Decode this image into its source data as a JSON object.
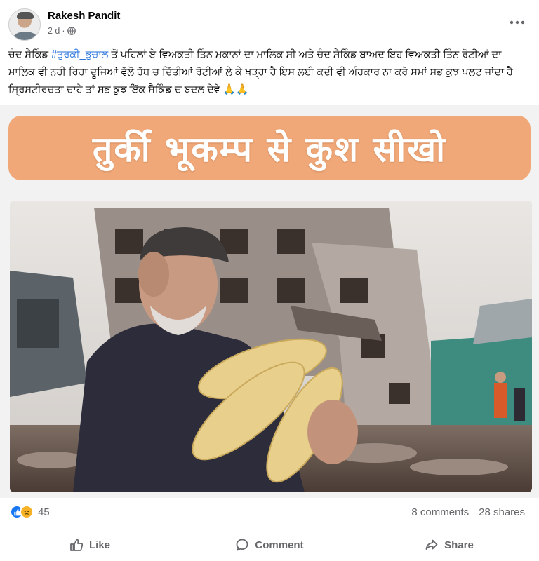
{
  "post": {
    "author": "Rakesh Pandit",
    "time": "2 d",
    "meta_separator": "·",
    "text_before_tag": "ਚੰਦ ਸੈਕਿੰਡ ",
    "hashtag": "#ਤੁਰਕੀ_ਭੁਚਾਲ",
    "text_after_tag": " ਤੋਂ ਪਹਿਲਾਂ ਏ ਵਿਅਕਤੀ ਤਿੰਨ ਮਕਾਨਾਂ ਦਾ ਮਾਲਿਕ ਸੀ ਅਤੇ ਚੰਦ ਸੈਕਿੰਡ ਬਾਅਦ ਇਹ ਵਿਅਕਤੀ ਤਿੰਨ ਰੋਟੀਆਂ ਦਾ ਮਾਲਿਕ ਵੀ ਨਹੀ ਰਿਹਾ ਦੂਜਿਆਂ ਵੱਲੋ ਹੱਥ ਚ ਦਿੱਤੀਆਂ ਰੋਟੀਆਂ ਲੇ ਕੇ ਖੜ੍ਹਾ ਹੈ ਇਸ ਲਈ ਕਦੀ ਵੀ ਅੰਹਕਾਰ ਨਾ ਕਰੋ ਸਮਾਂ ਸਭ ਕੁਝ ਪਲਟ ਜਾਂਦਾ ਹੈ ਸ੍ਰਿਸਟੀਰਚਤਾ ਚਾਹੇ ਤਾਂ ਸਭ ਕੁਝ ਇੱਕ ਸੈਕਿੰਡ ਚ ਬਦਲ ਦੇਵੇ 🙏🙏"
  },
  "image": {
    "banner_text": "तुर्की भूकम्प से कुश सीखो"
  },
  "stats": {
    "reaction_count": "45",
    "comments": "8 comments",
    "shares": "28 shares"
  },
  "actions": {
    "like": "Like",
    "comment": "Comment",
    "share": "Share"
  },
  "icons": {
    "globe": "globe-icon",
    "more": "more-options-icon",
    "like": "thumbs-up-icon",
    "comment": "comment-bubble-icon",
    "share": "share-arrow-icon",
    "reaction_like": "like-reaction-icon",
    "reaction_sad": "sad-reaction-icon"
  },
  "colors": {
    "hashtag": "#216fdb",
    "banner": "#f0a878",
    "like_reaction": "#1877f2",
    "sad_reaction": "#f7b125",
    "secondary_text": "#65676b"
  }
}
